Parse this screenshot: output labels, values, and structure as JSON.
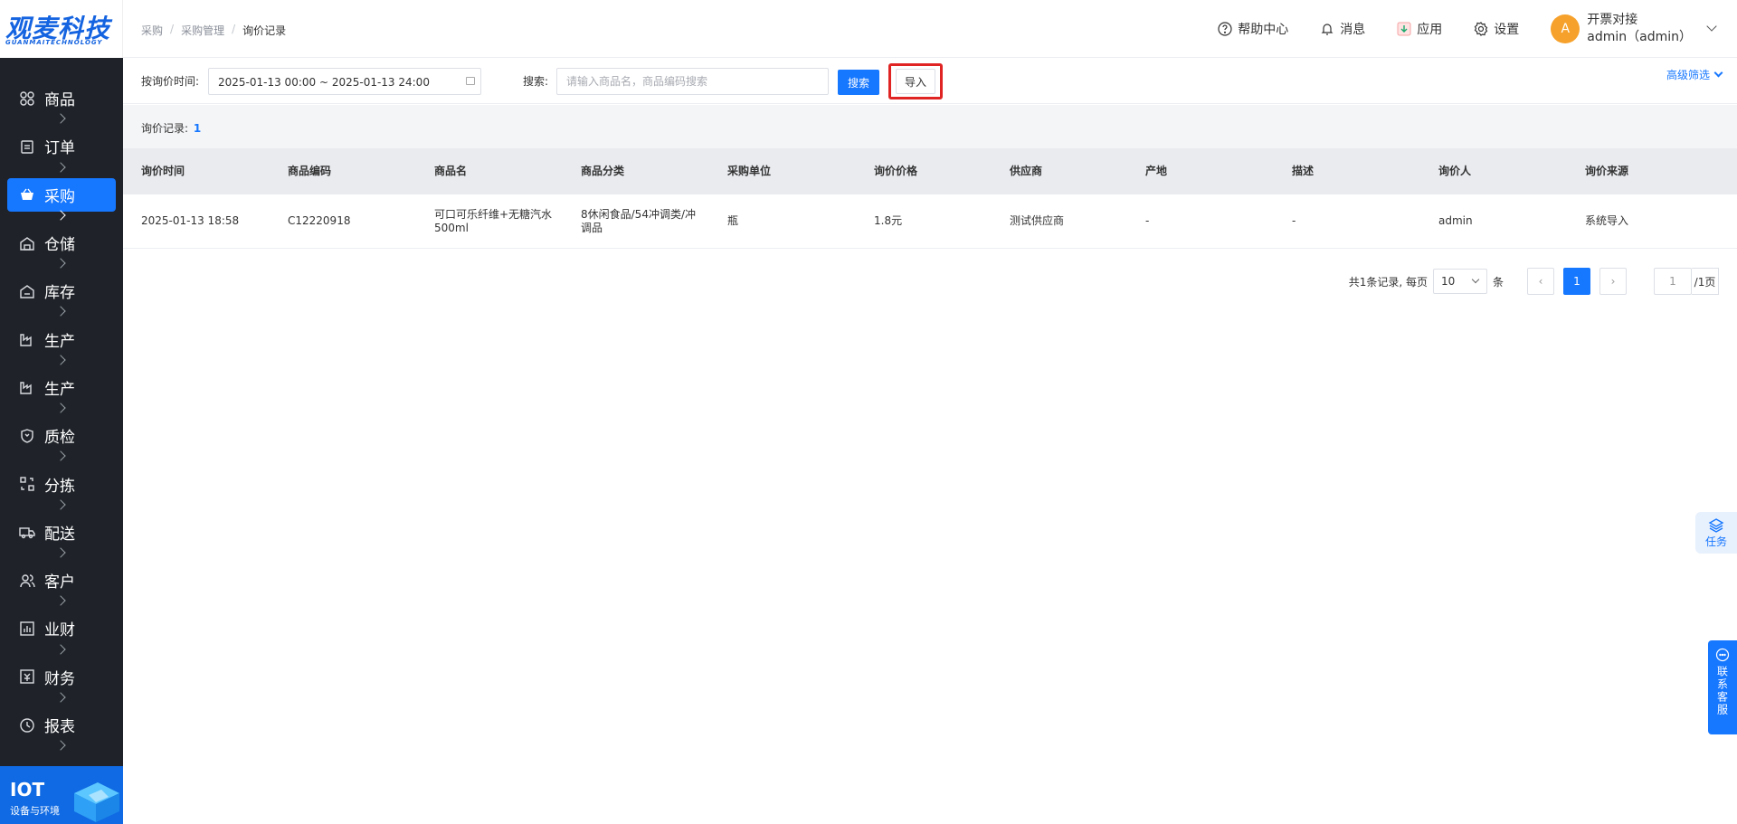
{
  "logo": {
    "title": "观麦科技",
    "sub": "GUANMAITECHNOLOGY"
  },
  "sidebar": {
    "items": [
      {
        "label": "商品",
        "icon": "grid-icon"
      },
      {
        "label": "订单",
        "icon": "clipboard-icon"
      },
      {
        "label": "采购",
        "icon": "basket-icon",
        "active": true
      },
      {
        "label": "仓储",
        "icon": "warehouse-icon"
      },
      {
        "label": "库存",
        "icon": "inventory-icon"
      },
      {
        "label": "生产",
        "icon": "factory-icon"
      },
      {
        "label": "生产",
        "icon": "factory-icon"
      },
      {
        "label": "质检",
        "icon": "shield-icon"
      },
      {
        "label": "分拣",
        "icon": "sort-icon"
      },
      {
        "label": "配送",
        "icon": "truck-icon"
      },
      {
        "label": "客户",
        "icon": "users-icon"
      },
      {
        "label": "业财",
        "icon": "bar-chart-icon"
      },
      {
        "label": "财务",
        "icon": "finance-icon"
      },
      {
        "label": "报表",
        "icon": "clock-icon"
      }
    ],
    "iot": {
      "title": "IOT",
      "sub": "设备与环境"
    }
  },
  "header": {
    "breadcrumb": [
      "采购",
      "采购管理",
      "询价记录"
    ],
    "help": "帮助中心",
    "messages": "消息",
    "apps": "应用",
    "settings": "设置",
    "user": {
      "avatar": "A",
      "name": "开票对接",
      "account": "admin（admin）"
    }
  },
  "filter": {
    "date_label": "按询价时间:",
    "date_value": "2025-01-13 00:00 ~ 2025-01-13 24:00",
    "search_label": "搜索:",
    "search_placeholder": "请输入商品名，商品编码搜索",
    "search_button": "搜索",
    "import_button": "导入",
    "advanced": "高级筛选"
  },
  "summary": {
    "label": "询价记录:",
    "count": "1"
  },
  "table": {
    "columns": [
      "询价时间",
      "商品编码",
      "商品名",
      "商品分类",
      "采购单位",
      "询价价格",
      "供应商",
      "产地",
      "描述",
      "询价人",
      "询价来源"
    ],
    "rows": [
      [
        "2025-01-13 18:58",
        "C12220918",
        "可口可乐纤维+无糖汽水500ml",
        "8休闲食品/54冲调类/冲调品",
        "瓶",
        "1.8元",
        "测试供应商",
        "-",
        "-",
        "admin",
        "系统导入"
      ]
    ]
  },
  "pagination": {
    "total_text": "共1条记录, 每页",
    "page_size": "10",
    "unit": "条",
    "prev": "‹",
    "current": "1",
    "next": "›",
    "jump_value": "1",
    "total_pages": "/1页"
  },
  "floats": {
    "task": "任务",
    "service": "联系客服"
  },
  "colors": {
    "primary": "#1677ff",
    "sidebar": "#1f2329",
    "highlight": "#e02424",
    "avatar": "#f6a12b"
  }
}
